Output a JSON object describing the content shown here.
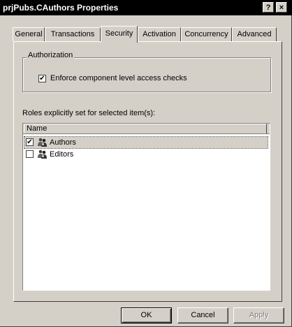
{
  "window": {
    "title": "prjPubs.CAuthors Properties",
    "help_glyph": "?",
    "close_glyph": "×"
  },
  "tabs": [
    {
      "label": "General",
      "active": false
    },
    {
      "label": "Transactions",
      "active": false
    },
    {
      "label": "Security",
      "active": true
    },
    {
      "label": "Activation",
      "active": false
    },
    {
      "label": "Concurrency",
      "active": false
    },
    {
      "label": "Advanced",
      "active": false
    }
  ],
  "authorization": {
    "group_label": "Authorization",
    "enforce_checks_label": "Enforce component level access checks",
    "enforce_checks_checked": true
  },
  "roles": {
    "caption": "Roles explicitly set for selected item(s):",
    "column_header": "Name",
    "items": [
      {
        "name": "Authors",
        "checked": true,
        "selected": true,
        "icon": "role-icon"
      },
      {
        "name": "Editors",
        "checked": false,
        "selected": false,
        "icon": "role-icon"
      }
    ]
  },
  "buttons": {
    "ok": "OK",
    "cancel": "Cancel",
    "apply": "Apply",
    "apply_enabled": false
  },
  "check_glyph": "✔"
}
